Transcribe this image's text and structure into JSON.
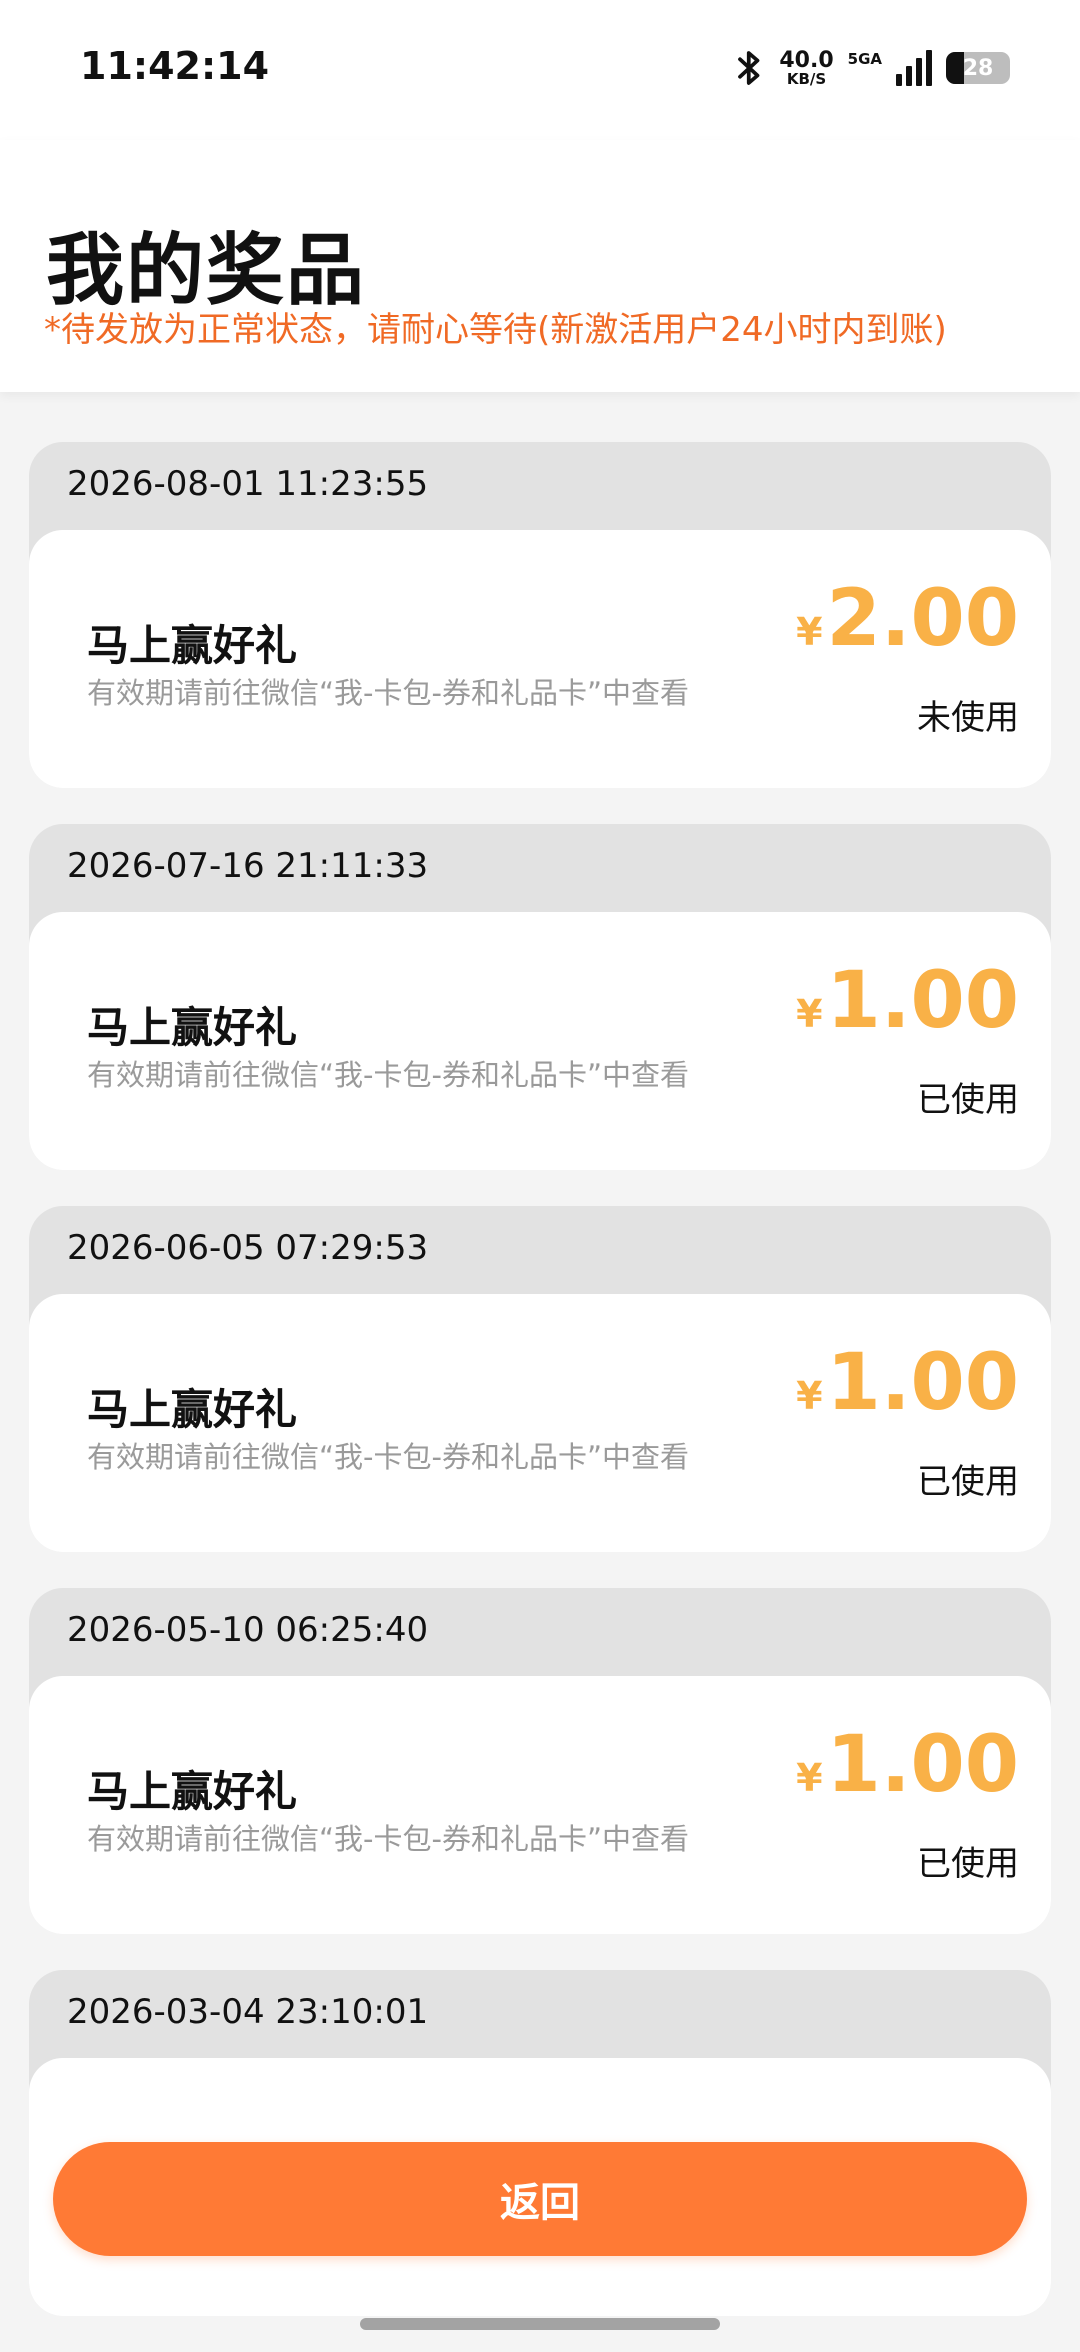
{
  "status_bar": {
    "time": "11:42:14",
    "net_speed": "40.0",
    "net_unit": "KB/S",
    "net_type": "5GA",
    "battery": "28"
  },
  "header": {
    "title": "我的奖品",
    "notice": "*待发放为正常状态，请耐心等待(新激活用户24小时内到账)"
  },
  "prizes": [
    {
      "time": "2026-08-01 11:23:55",
      "title": "马上赢好礼",
      "desc": "有效期请前往微信“我-卡包-券和礼品卡”中查看",
      "currency": "¥",
      "amount": "2.00",
      "status": "未使用"
    },
    {
      "time": "2026-07-16 21:11:33",
      "title": "马上赢好礼",
      "desc": "有效期请前往微信“我-卡包-券和礼品卡”中查看",
      "currency": "¥",
      "amount": "1.00",
      "status": "已使用"
    },
    {
      "time": "2026-06-05 07:29:53",
      "title": "马上赢好礼",
      "desc": "有效期请前往微信“我-卡包-券和礼品卡”中查看",
      "currency": "¥",
      "amount": "1.00",
      "status": "已使用"
    },
    {
      "time": "2026-05-10 06:25:40",
      "title": "马上赢好礼",
      "desc": "有效期请前往微信“我-卡包-券和礼品卡”中查看",
      "currency": "¥",
      "amount": "1.00",
      "status": "已使用"
    },
    {
      "time": "2026-03-04 23:10:01",
      "title": "",
      "desc": "",
      "currency": "",
      "amount": "",
      "status": ""
    }
  ],
  "back_button": {
    "label": "返回"
  },
  "colors": {
    "accent": "#ff7a35",
    "amount": "#f9b147",
    "notice": "#f06a25"
  }
}
